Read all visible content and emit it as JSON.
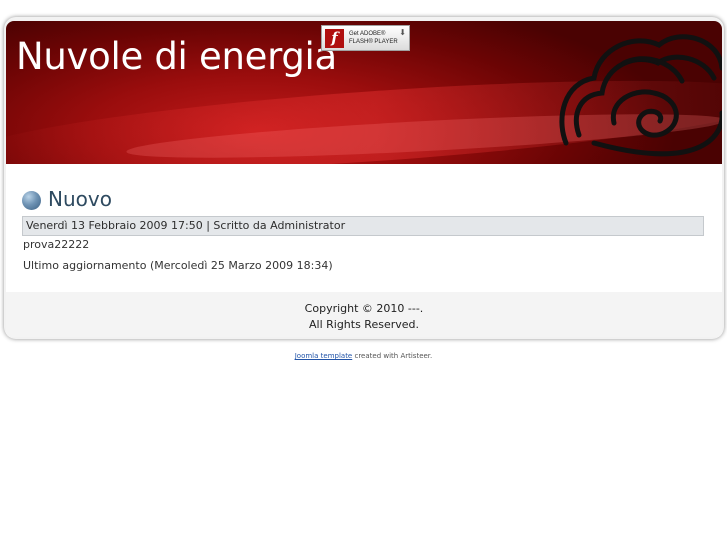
{
  "header": {
    "site_title": "Nuvole di energia",
    "flash_badge": {
      "line1": "Get ADOBE®",
      "line2": "FLASH® PLAYER",
      "logo_glyph": "f",
      "icon": "flash-player-badge"
    },
    "colors": {
      "header_dark": "#6a0404",
      "header_bright": "#c21a1a"
    }
  },
  "article": {
    "title": "Nuovo",
    "meta": "Venerdì 13 Febbraio 2009 17:50 | Scritto da Administrator",
    "body": "prova22222",
    "last_updated": "Ultimo aggiornamento (Mercoledì 25 Marzo 2009 18:34)",
    "title_color": "#2e4a60"
  },
  "footer": {
    "copyright_line1": "Copyright © 2010 ---.",
    "copyright_line2": "All Rights Reserved."
  },
  "credit": {
    "link_text": "Joomla template",
    "rest_text": " created with Artisteer."
  }
}
